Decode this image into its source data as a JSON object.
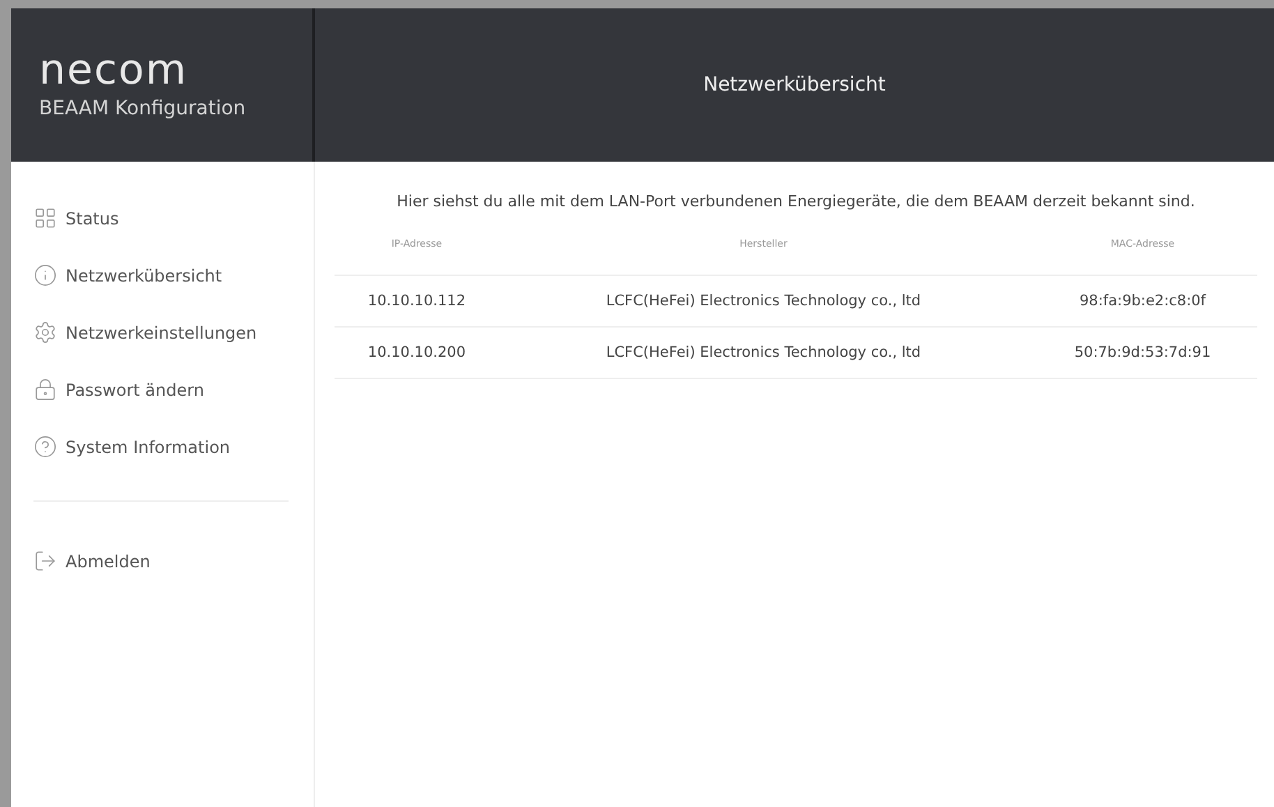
{
  "brand": {
    "logo": "necom",
    "subtitle": "BEAAM Konfiguration"
  },
  "header": {
    "title": "Netzwerkübersicht"
  },
  "sidebar": {
    "items": [
      {
        "kind": "grid",
        "label": "Status"
      },
      {
        "kind": "info",
        "label": "Netzwerkübersicht"
      },
      {
        "kind": "gear",
        "label": "Netzwerkeinstellungen"
      },
      {
        "kind": "lock",
        "label": "Passwort ändern"
      },
      {
        "kind": "help",
        "label": "System Information"
      }
    ],
    "logout": {
      "label": "Abmelden"
    }
  },
  "intro": "Hier siehst du alle mit dem LAN-Port verbundenen Energiegeräte, die dem BEAAM derzeit bekannt sind.",
  "table": {
    "columns": [
      "IP-Adresse",
      "Hersteller",
      "MAC-Adresse"
    ],
    "rows": [
      [
        "10.10.10.112",
        "LCFC(HeFei) Electronics Technology co., ltd",
        "98:fa:9b:e2:c8:0f"
      ],
      [
        "10.10.10.200",
        "LCFC(HeFei) Electronics Technology co., ltd",
        "50:7b:9d:53:7d:91"
      ]
    ]
  }
}
